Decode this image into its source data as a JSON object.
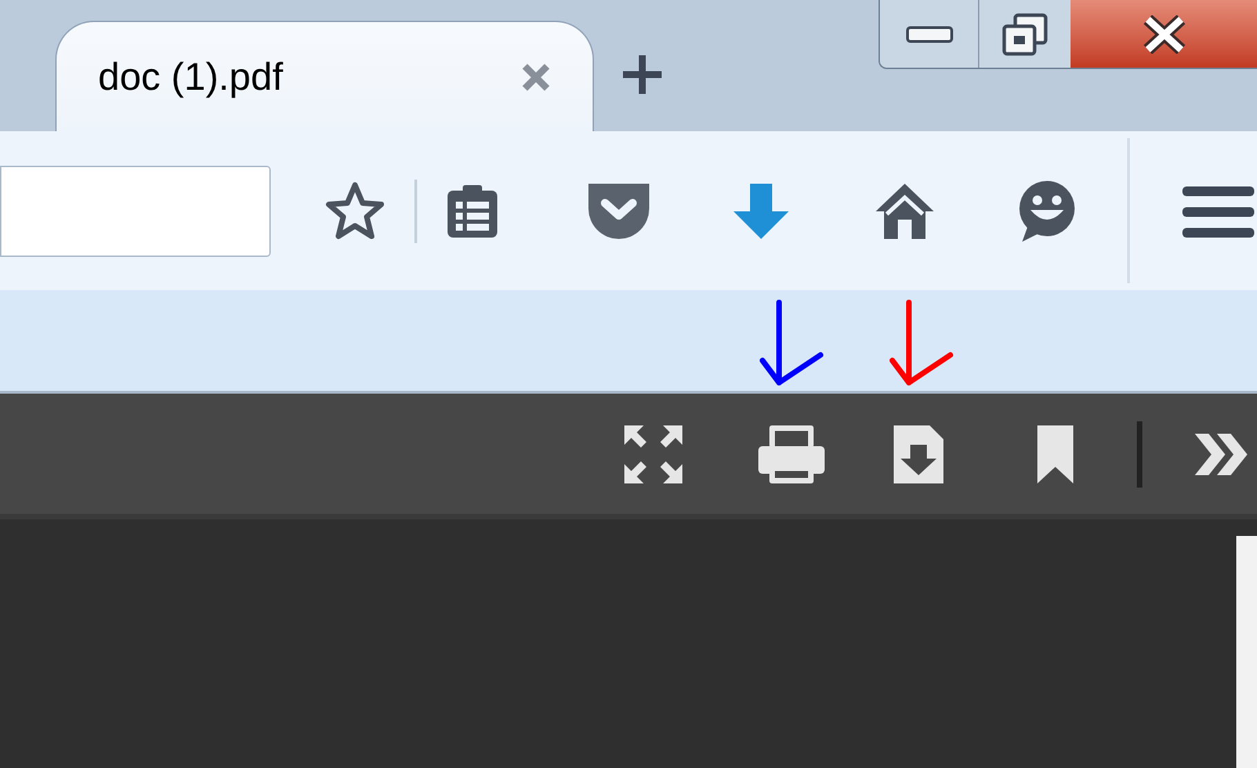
{
  "tabs": [
    {
      "title": "doc (1).pdf",
      "selected": true
    }
  ],
  "annotation_arrows": [
    {
      "color": "#0000ff"
    },
    {
      "color": "#ff0000"
    }
  ]
}
